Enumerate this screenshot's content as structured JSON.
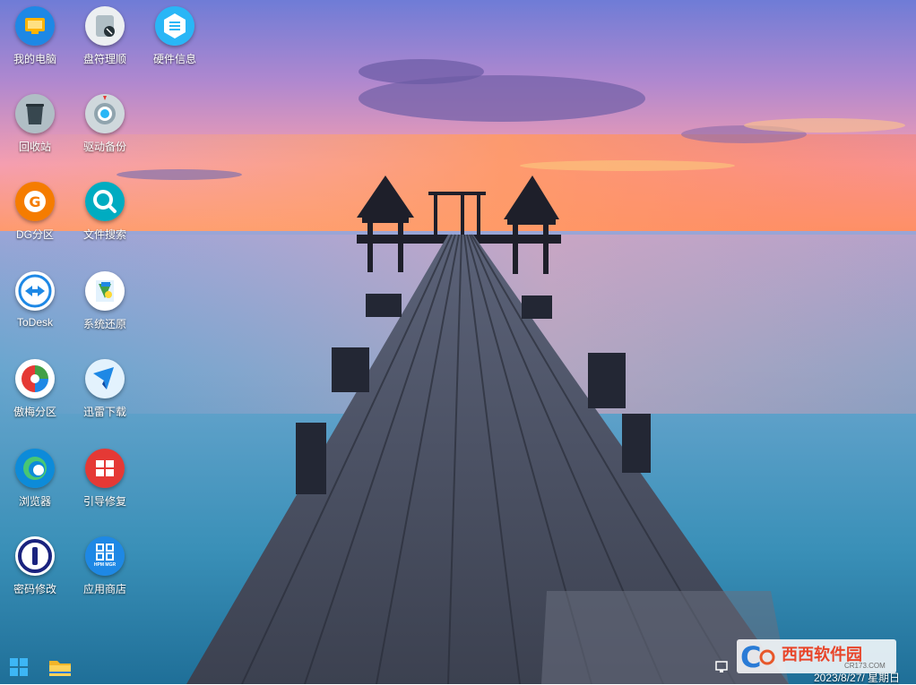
{
  "desktop": {
    "icons": [
      {
        "label": "我的电脑",
        "icon": "computer-icon"
      },
      {
        "label": "盘符理顺",
        "icon": "drive-letter-icon"
      },
      {
        "label": "硬件信息",
        "icon": "hardware-info-icon"
      },
      {
        "label": "回收站",
        "icon": "recycle-bin-icon"
      },
      {
        "label": "驱动备份",
        "icon": "driver-backup-icon"
      },
      {
        "label": "DG分区",
        "icon": "diskgenius-icon"
      },
      {
        "label": "文件搜索",
        "icon": "file-search-icon"
      },
      {
        "label": "ToDesk",
        "icon": "todesk-icon"
      },
      {
        "label": "系统还原",
        "icon": "system-restore-icon"
      },
      {
        "label": "傲梅分区",
        "icon": "aomei-partition-icon"
      },
      {
        "label": "迅雷下载",
        "icon": "thunder-download-icon"
      },
      {
        "label": "浏览器",
        "icon": "edge-browser-icon"
      },
      {
        "label": "引导修复",
        "icon": "boot-repair-icon"
      },
      {
        "label": "密码修改",
        "icon": "password-icon"
      },
      {
        "label": "应用商店",
        "icon": "app-store-icon"
      }
    ],
    "app_store_icon_text": "HPM MGR"
  },
  "taskbar": {
    "start_icon": "windows-start-icon",
    "explorer_icon": "file-explorer-icon",
    "tray_icon": "network-icon",
    "clock": "2023/8/27/ 星期日"
  },
  "watermark": {
    "logo_text": "西西软件园",
    "domain_text": "CR173.COM"
  },
  "colors": {
    "sky_top": "#7480d8",
    "sunset": "#ff8a5c",
    "sea": "#3a86b0",
    "accent_blue": "#1e88e5"
  }
}
